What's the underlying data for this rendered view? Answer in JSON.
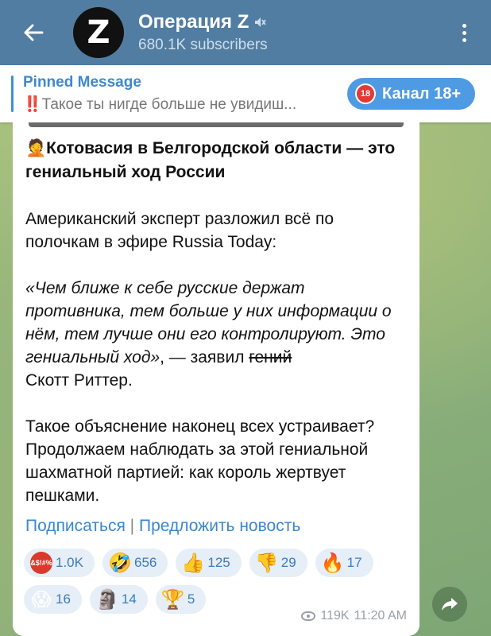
{
  "header": {
    "back_icon": "arrow-left-icon",
    "avatar_letter": "Z",
    "channel_name": "Операция Z",
    "mute_icon": "mute-icon",
    "subscribers": "680.1K subscribers",
    "menu_icon": "more-vertical-icon"
  },
  "pinned": {
    "title": "Pinned Message",
    "preview_mark": "‼️",
    "preview_text": "Такое ты нигде больше не увидиш...",
    "badge_icon": "18",
    "badge_label": "Канал 18+"
  },
  "message": {
    "headline_emoji": "🤦",
    "headline": "Котовасия в Белгородской области — это гениальный ход России",
    "para1": "Американский эксперт разложил всё по полочкам в эфире Russia Today:",
    "quote": "«Чем ближе к себе русские держат противника, тем больше у них информации о нём, тем лучше они его контролируют. Это гениальный ход»",
    "said_by": ", — заявил ",
    "strike_word": "гений",
    "author": "Скотт Риттер.",
    "para3": "Такое объяснение наконец всех устраивает? Продолжаем наблюдать за этой гениальной шахматной партией: как король жертвует пешками.",
    "link_subscribe": "Подписаться",
    "link_separator": "|",
    "link_suggest": "Предложить новость",
    "views": "119K",
    "time": "11:20 AM"
  },
  "reactions": [
    {
      "emoji": "&$!#%",
      "count": "1.0K",
      "color": "#d93a2b"
    },
    {
      "emoji": "🤣",
      "count": "656",
      "color": "#f6c337"
    },
    {
      "emoji": "👍",
      "count": "125",
      "color": "#f6c337"
    },
    {
      "emoji": "👎",
      "count": "29",
      "color": "#f6c337"
    },
    {
      "emoji": "🔥",
      "count": "17",
      "color": "#ef6c00"
    },
    {
      "emoji": "😱",
      "count": "16",
      "color": "#f6c337"
    },
    {
      "emoji": "🗿",
      "count": "14",
      "color": "#8d8d8d"
    },
    {
      "emoji": "🏆",
      "count": "5",
      "color": "#e0a414"
    }
  ],
  "share_icon": "share-arrow-icon"
}
